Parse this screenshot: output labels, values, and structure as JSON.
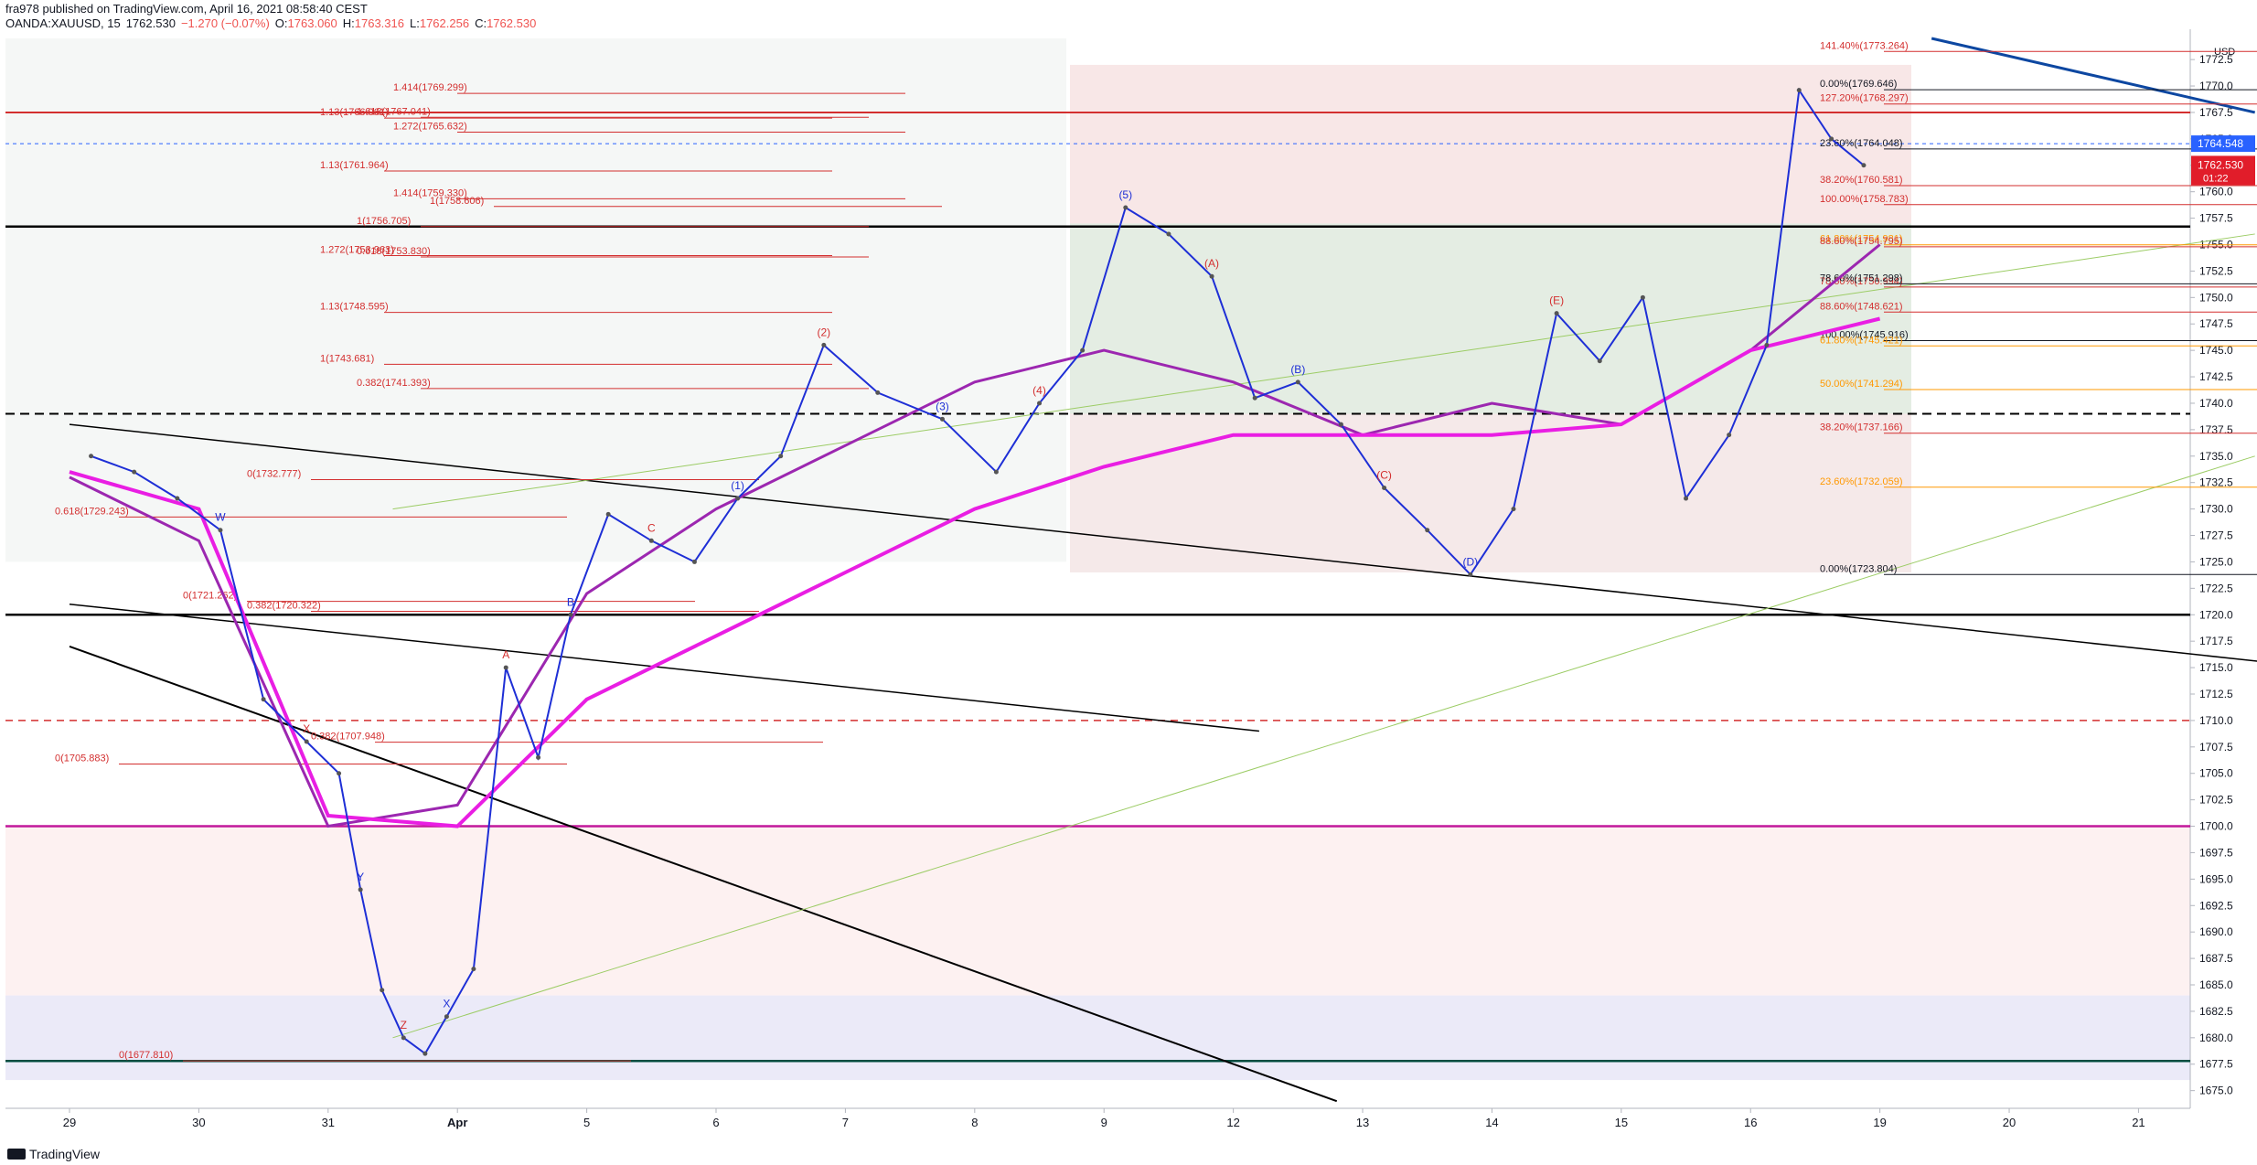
{
  "header": {
    "published": "fra978 published on TradingView.com, April 16, 2021 08:58:40 CEST",
    "symbol": "OANDA:XAUUSD, 15",
    "last": "1762.530",
    "change": "−1.270 (−0.07%)",
    "o_label": "O:",
    "o_value": "1763.060",
    "h_label": "H:",
    "h_value": "1763.316",
    "l_label": "L:",
    "l_value": "1762.256",
    "c_label": "C:",
    "c_value": "1762.530"
  },
  "footer": {
    "brand": "TradingView"
  },
  "colors": {
    "up": "#2962ff",
    "down": "#ef5350",
    "ma_magenta": "#e91ee3",
    "ma_purple": "#9c27b0",
    "ma_blue": "#1e2fd6",
    "fib_red": "#d32f2f",
    "fib_orange": "#ff9800",
    "fib_green": "#43a047",
    "price_tag_red": "#e11d2a",
    "price_tag_blue": "#2962ff"
  },
  "chart_data": {
    "type": "line",
    "title": "",
    "currency_label": "USD",
    "x_ticks": [
      "29",
      "30",
      "31",
      "Apr",
      "5",
      "6",
      "7",
      "8",
      "9",
      "12",
      "13",
      "14",
      "15",
      "16",
      "19",
      "20",
      "21"
    ],
    "y_ticks": [
      1675,
      1677.5,
      1680,
      1682.5,
      1685,
      1687.5,
      1690,
      1692.5,
      1695,
      1697.5,
      1700,
      1702.5,
      1705,
      1707.5,
      1710,
      1712.5,
      1715,
      1717.5,
      1720,
      1722.5,
      1725,
      1727.5,
      1730,
      1732.5,
      1735,
      1737.5,
      1740,
      1742.5,
      1745,
      1747.5,
      1750,
      1752.5,
      1755,
      1757.5,
      1760,
      1762.5,
      1765,
      1767.5,
      1770,
      1772.5
    ],
    "ylim": [
      1673.5,
      1774.5
    ],
    "price_labels": {
      "current": "1762.530",
      "countdown": "01:22",
      "blue_level": "1764.548"
    },
    "series": [
      {
        "name": "XAUUSD",
        "color": "#555555",
        "points": [
          [
            "29",
            1735.0
          ],
          [
            "29",
            1733.5
          ],
          [
            "29",
            1731.0
          ],
          [
            "30",
            1728.0
          ],
          [
            "30",
            1712.0
          ],
          [
            "30",
            1708.0
          ],
          [
            "31",
            1705.0
          ],
          [
            "31",
            1694.0
          ],
          [
            "31",
            1684.5
          ],
          [
            "31",
            1680.0
          ],
          [
            "31",
            1678.5
          ],
          [
            "31",
            1682.0
          ],
          [
            "Apr",
            1686.5
          ],
          [
            "Apr",
            1715.0
          ],
          [
            "Apr",
            1706.5
          ],
          [
            "Apr",
            1720.0
          ],
          [
            "5",
            1729.5
          ],
          [
            "5",
            1727.0
          ],
          [
            "5",
            1725.0
          ],
          [
            "6",
            1731.0
          ],
          [
            "6",
            1735.0
          ],
          [
            "6",
            1745.5
          ],
          [
            "7",
            1741.0
          ],
          [
            "7",
            1738.5
          ],
          [
            "8",
            1733.5
          ],
          [
            "8",
            1740.0
          ],
          [
            "8",
            1745.0
          ],
          [
            "9",
            1758.5
          ],
          [
            "9",
            1756.0
          ],
          [
            "9",
            1752.0
          ],
          [
            "12",
            1740.5
          ],
          [
            "12",
            1742.0
          ],
          [
            "12",
            1738.0
          ],
          [
            "13",
            1732.0
          ],
          [
            "13",
            1728.0
          ],
          [
            "13",
            1723.8
          ],
          [
            "14",
            1730.0
          ],
          [
            "14",
            1748.5
          ],
          [
            "14",
            1744.0
          ],
          [
            "15",
            1750.0
          ],
          [
            "15",
            1731.0
          ],
          [
            "15",
            1737.0
          ],
          [
            "16",
            1745.5
          ],
          [
            "16",
            1769.6
          ],
          [
            "16",
            1765.0
          ],
          [
            "16",
            1762.5
          ]
        ]
      }
    ],
    "fib_labels": [
      {
        "text": "141.40%(1773.264)",
        "price": 1773.264
      },
      {
        "text": "0.00%(1769.646)",
        "price": 1769.646
      },
      {
        "text": "1.414(1769.299)",
        "price": 1769.299
      },
      {
        "text": "127.20%(1768.297)",
        "price": 1768.297
      },
      {
        "text": "1.13(1766.961)",
        "price": 1766.961
      },
      {
        "text": "1.618(1767.041)",
        "price": 1767.041
      },
      {
        "text": "1.272(1765.632)",
        "price": 1765.632
      },
      {
        "text": "23.60%(1764.048)",
        "price": 1764.048
      },
      {
        "text": "1.13(1761.964)",
        "price": 1761.964
      },
      {
        "text": "38.20%(1760.581)",
        "price": 1760.581
      },
      {
        "text": "1.414(1759.330)",
        "price": 1759.33
      },
      {
        "text": "1(1758.606)",
        "price": 1758.606
      },
      {
        "text": "100.00%(1758.783)",
        "price": 1758.783
      },
      {
        "text": "1(1756.705)",
        "price": 1756.705
      },
      {
        "text": "61.80%(1754.981)",
        "price": 1754.981
      },
      {
        "text": "88.60%(1754.795)",
        "price": 1754.795
      },
      {
        "text": "1.272(1753.963)",
        "price": 1753.963
      },
      {
        "text": "0.618(1753.830)",
        "price": 1753.83
      },
      {
        "text": "78.60%(1750.994)",
        "price": 1750.994
      },
      {
        "text": "78.60%(1751.298)",
        "price": 1751.298
      },
      {
        "text": "1.13(1748.595)",
        "price": 1748.595
      },
      {
        "text": "88.60%(1748.621)",
        "price": 1748.621
      },
      {
        "text": "100.00%(1745.916)",
        "price": 1745.916
      },
      {
        "text": "61.80%(1745.421)",
        "price": 1745.421
      },
      {
        "text": "1(1743.681)",
        "price": 1743.681
      },
      {
        "text": "0.382(1741.393)",
        "price": 1741.393
      },
      {
        "text": "50.00%(1741.294)",
        "price": 1741.294
      },
      {
        "text": "38.20%(1737.166)",
        "price": 1737.166
      },
      {
        "text": "0(1732.777)",
        "price": 1732.777
      },
      {
        "text": "23.60%(1732.059)",
        "price": 1732.059
      },
      {
        "text": "0.618(1729.243)",
        "price": 1729.243
      },
      {
        "text": "0.00%(1723.804)",
        "price": 1723.804
      },
      {
        "text": "0(1721.262)",
        "price": 1721.262
      },
      {
        "text": "0.382(1720.322)",
        "price": 1720.322
      },
      {
        "text": "0.382(1707.948)",
        "price": 1707.948
      },
      {
        "text": "0(1705.883)",
        "price": 1705.883
      },
      {
        "text": "0(1677.810)",
        "price": 1677.81
      }
    ],
    "wave_labels": [
      "W",
      "X",
      "Y",
      "Z",
      "X",
      "A",
      "B",
      "C",
      "(1)",
      "(2)",
      "(3)",
      "(4)",
      "(5)",
      "(A)",
      "(B)",
      "(C)",
      "(D)",
      "(E)"
    ],
    "grid": true,
    "legend": "none"
  }
}
